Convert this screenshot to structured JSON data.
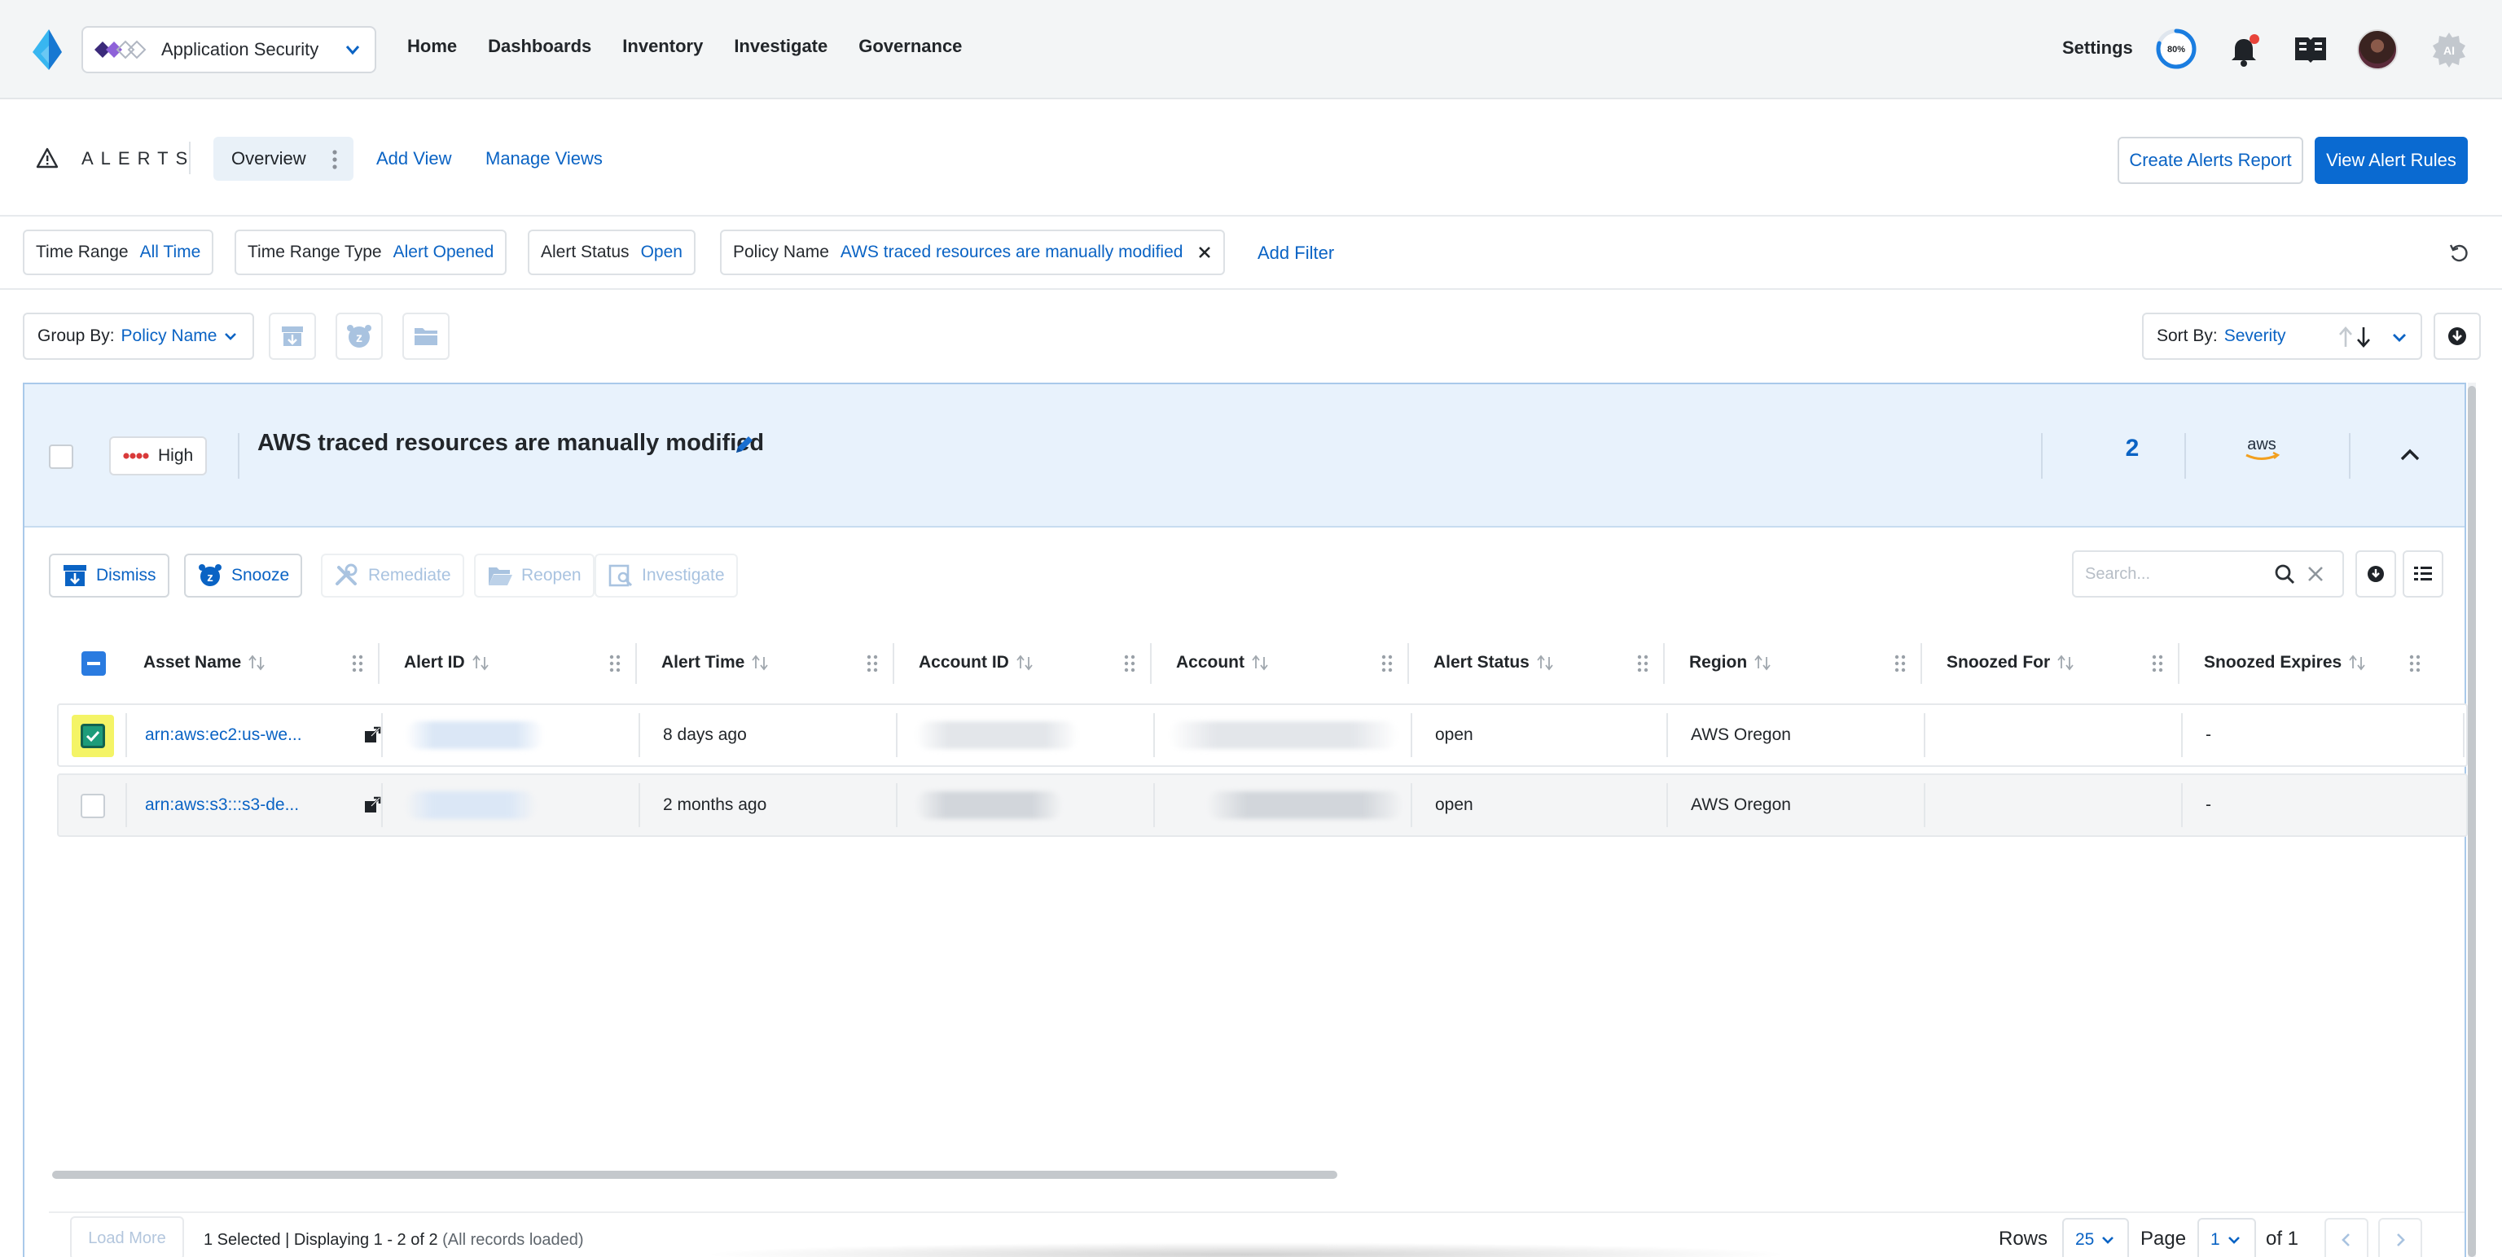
{
  "app": {
    "name": "Application Security"
  },
  "nav": {
    "items": [
      "Home",
      "Dashboards",
      "Inventory",
      "Investigate",
      "Governance"
    ],
    "settings": "Settings",
    "progress": "80%",
    "progress_value": 0.8
  },
  "alerts_header": {
    "title": "ALERTS",
    "active_tab": "Overview",
    "add_view": "Add View",
    "manage_views": "Manage Views",
    "create_report": "Create Alerts Report",
    "view_rules": "View Alert Rules"
  },
  "filters": [
    {
      "key": "Time Range",
      "value": "All Time"
    },
    {
      "key": "Time Range Type",
      "value": "Alert Opened"
    },
    {
      "key": "Alert Status",
      "value": "Open"
    },
    {
      "key": "Policy Name",
      "value": "AWS traced resources are manually modified"
    }
  ],
  "add_filter": "Add Filter",
  "group_by": {
    "label": "Group By:",
    "value": "Policy Name"
  },
  "sort_by": {
    "label": "Sort By:",
    "value": "Severity"
  },
  "group": {
    "severity": "High",
    "title": "AWS traced resources are manually modified",
    "count": "2",
    "cloud": "aws"
  },
  "actions": {
    "dismiss": "Dismiss",
    "snooze": "Snooze",
    "remediate": "Remediate",
    "reopen": "Reopen",
    "investigate": "Investigate"
  },
  "search": {
    "placeholder": "Search..."
  },
  "table": {
    "columns": [
      "Asset Name",
      "Alert ID",
      "Alert Time",
      "Account ID",
      "Account",
      "Alert Status",
      "Region",
      "Snoozed For",
      "Snoozed Expires"
    ],
    "rows": [
      {
        "asset": "arn:aws:ec2:us-we...",
        "alert_time": "8 days ago",
        "status": "open",
        "region": "AWS Oregon",
        "snoozed_for": "",
        "snoozed_expires": "-",
        "selected": true
      },
      {
        "asset": "arn:aws:s3:::s3-de...",
        "alert_time": "2 months ago",
        "status": "open",
        "region": "AWS Oregon",
        "snoozed_for": "",
        "snoozed_expires": "-",
        "selected": false
      }
    ]
  },
  "footer": {
    "load_more": "Load More",
    "selection": "1 Selected | Displaying 1 - 2 of 2",
    "loaded": "(All records loaded)",
    "rows_label": "Rows",
    "rows_value": "25",
    "page_label": "Page",
    "page_value": "1",
    "of_label": "of 1"
  },
  "colors": {
    "accent": "#0a63c4",
    "primary_button": "#0a6ad1",
    "group_header": "#e8f2fc",
    "checked": "#1d9c7a",
    "highlight": "#f4f466"
  }
}
